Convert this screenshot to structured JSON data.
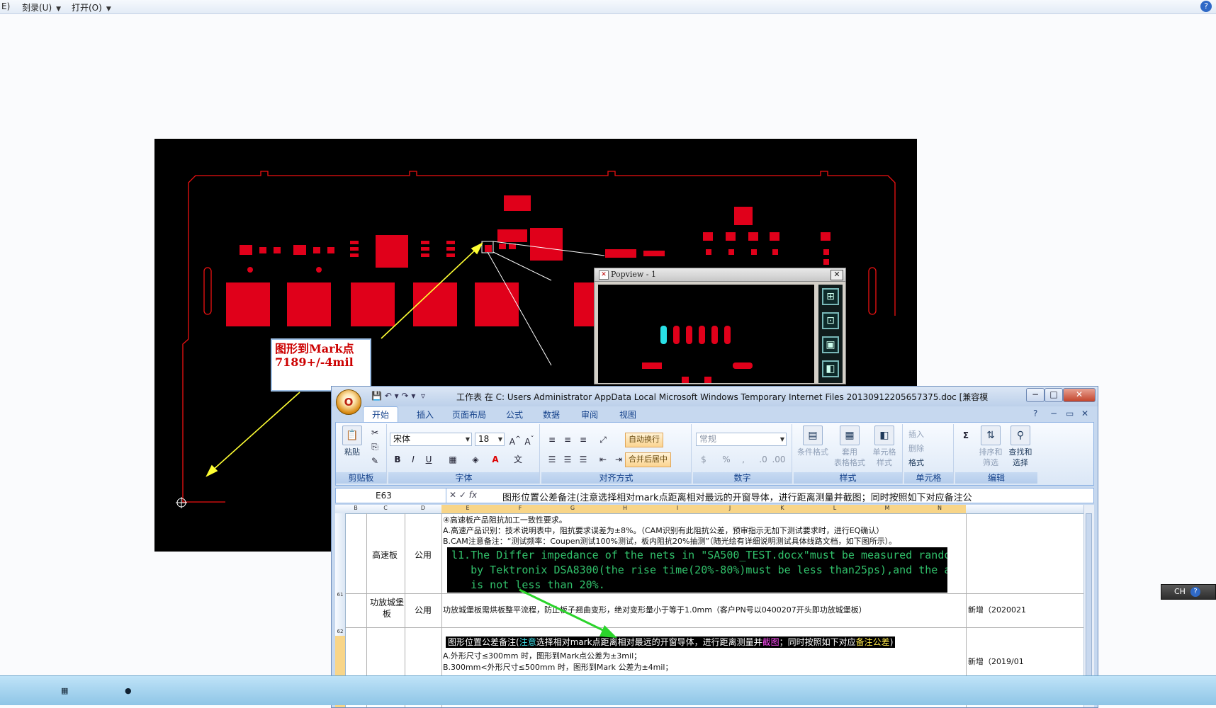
{
  "explorer": {
    "menu_e": "E)",
    "menu_burn": "刻录(U)",
    "menu_open": "打开(O)",
    "help": "?"
  },
  "cam": {
    "annotation_line1": "图形到Mark点",
    "annotation_line2": "7189+/-4mil",
    "line_color": "#ff0000",
    "pad_color": "#e0001a",
    "arrow_color": "#ffff33"
  },
  "popview": {
    "title": "Popview - 1",
    "close": "✕",
    "tools": [
      "zoom-in-icon",
      "zoom-out-icon",
      "fit-icon",
      "pan-icon"
    ]
  },
  "excel": {
    "title": "工作表 在 C: Users Administrator AppData Local Microsoft Windows Temporary Internet Files 20130912205657375.doc [兼容模式] - M...",
    "orb": "O",
    "tabs": [
      "开始",
      "插入",
      "页面布局",
      "公式",
      "数据",
      "审阅",
      "视图"
    ],
    "ribbon": {
      "clipboard": {
        "paste": "粘贴",
        "label": "剪贴板"
      },
      "font": {
        "name": "宋体",
        "size": "18",
        "bold": "B",
        "italic": "I",
        "underline": "U",
        "label": "字体"
      },
      "align": {
        "wrap": "自动换行",
        "merge": "合并后居中",
        "label": "对齐方式"
      },
      "number": {
        "format": "常规",
        "label": "数字"
      },
      "styles": {
        "cond": "条件格式",
        "table_a": "套用",
        "table_b": "表格格式",
        "cell_a": "单元格",
        "cell_b": "样式",
        "label": "样式"
      },
      "cells": {
        "insert": "插入",
        "delete": "删除",
        "format": "格式",
        "label": "单元格"
      },
      "edit": {
        "sum": "Σ",
        "sort_a": "排序和",
        "sort_b": "筛选",
        "find_a": "查找和",
        "find_b": "选择",
        "label": "编辑"
      }
    },
    "formula_bar": {
      "name_box": "E63",
      "formula": "图形位置公差备注(注意选择相对mark点距离相对最远的开窗导体，进行距离测量并截图；同时按照如下对应备注公"
    },
    "columns": [
      "B",
      "C",
      "D",
      "E",
      "F",
      "G",
      "H",
      "I",
      "J",
      "K",
      "L",
      "M",
      "N"
    ],
    "rows": {
      "r61": "61",
      "r62": "62",
      "r61_c": "高速板",
      "r61_d": "公用",
      "r61_l1": "④高速板产品阻抗加工一致性要求。",
      "r61_l2": "A.高速产品识别：技术说明表中，阻抗要求误差为±8%。（CAM识别有此阻抗公差，预审指示无加下测试要求时，进行EQ确认）",
      "r61_l3": "B.CAM注意备注：“测试频率：Coupen测试100%测试，板内阻抗20%抽测”（随光绘有详细说明测试具体线路文档，如下图所示）。",
      "code": "l1.The Differ impedance of the nets in \"SA500_TEST.docx\"must be measured random\n   by Tektronix DSA8300(the rise time(20%-80%)must be less than25ps),and the amount\n   is not less than 20%.",
      "r62_c": "功放城堡板",
      "r62_d": "公用",
      "r62_e": "功放城堡板需烘板整平流程，防止板子翘曲变形，绝对变形量小于等于1.0mm（客户PN号以0400207开头即功放城堡板）",
      "r62_o": "新增（2020021",
      "r63_a": "图形位置公差备注(",
      "r63_b": "注意",
      "r63_c": "选择相对mark点距离相对最远的开窗导体，进行距离测量并",
      "r63_d": "截图",
      "r63_e": "；同时按照如下对应",
      "r63_f": "备注公差",
      "r63_g": ")",
      "r63_l2": "A.外形尺寸≤300mm 时，图形到Mark点公差为±3mil；",
      "r63_l3": "B.300mm<外形尺寸≤500mm 时，图形到Mark 公差为±4mil；",
      "r63_o": "新增（2019/01"
    }
  },
  "ime": {
    "lang": "CH",
    "help": "?"
  }
}
